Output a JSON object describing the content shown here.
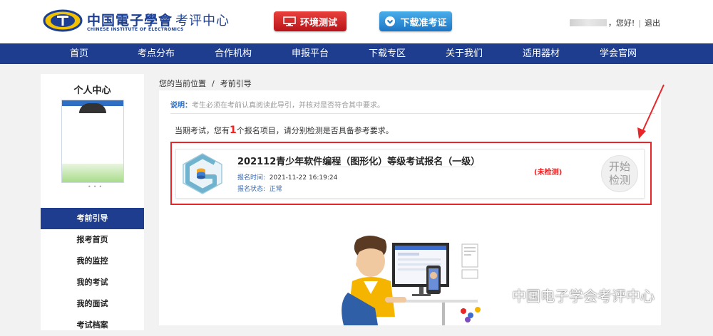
{
  "header": {
    "logo_cn": "中国電子學會",
    "logo_sub": "考评中心",
    "logo_en": "CHINESE INSTITUTE OF ELECTRONICS",
    "env_test_label": "环境测试",
    "download_admission_label": "下载准考证",
    "greeting": "，您好!",
    "logout_label": "退出"
  },
  "nav": {
    "items": [
      "首页",
      "考点分布",
      "合作机构",
      "申报平台",
      "下载专区",
      "关于我们",
      "适用器材",
      "学会官网"
    ]
  },
  "sidebar": {
    "title": "个人中心",
    "menu": [
      "考前引导",
      "报考首页",
      "我的监控",
      "我的考试",
      "我的面试",
      "考试档案"
    ],
    "active_index": 0
  },
  "breadcrumb": {
    "current": "您的当前位置",
    "page": "考前引导"
  },
  "notice": {
    "label": "说明：",
    "text": "考生必须在考前认真阅读此导引，并核对是否符合其中要求。"
  },
  "intro": {
    "prefix": "当期考试，您有",
    "count": "1",
    "suffix": "个报名项目，请分别检测是否具备参考要求。"
  },
  "exam": {
    "title": "202112青少年软件编程（图形化）等级考试报名（一级）",
    "time_label": "报名时间:",
    "time_value": "2021-11-22 16:19:24",
    "status_label": "报名状态:",
    "status_value": "正常",
    "check_status": "(未检测)",
    "start_line1": "开始",
    "start_line2": "检测"
  },
  "watermark": "中国电子学会考评中心",
  "colors": {
    "nav_bg": "#1e3d8f",
    "accent_red": "#e8262a",
    "brand_blue": "#1c3f91"
  }
}
